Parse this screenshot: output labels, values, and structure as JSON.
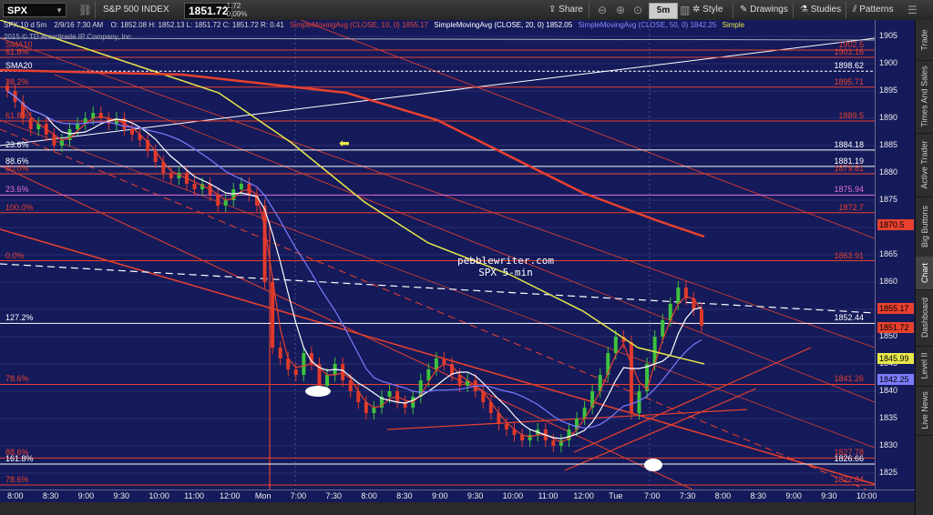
{
  "toolbar": {
    "symbol": "SPX",
    "index_name": "S&P 500 INDEX",
    "last_price": "1851.72",
    "change": "-1.72",
    "change_pct": "-0.09%",
    "share_label": "Share",
    "timeframe": "5m",
    "style_label": "Style",
    "drawings_label": "Drawings",
    "studies_label": "Studies",
    "patterns_label": "Patterns"
  },
  "legend": {
    "header": "SPX 10 d 5m",
    "date": "2/9/16 7:30 AM",
    "ohlc": "O: 1852.08  H: 1852.13  L: 1851.72  C: 1851.72  R: 0.41",
    "sma10": "SimpleMovingAvg (CLOSE, 10, 0)",
    "sma10_val": "1855.17",
    "sma20": "SimpleMovingAvg (CLOSE, 20, 0)",
    "sma20_val": "1852.05",
    "sma50": "SimpleMovingAvg (CLOSE, 50, 0)",
    "sma50_val": "1842.25",
    "sma_more": "Simple"
  },
  "copyright": "2015 © TD Ameritrade IP Company, Inc.",
  "watermark": {
    "line1": "pebblewriter.com",
    "line2": "SPX 5-min"
  },
  "sidebar_tabs": [
    "Trade",
    "Times And Sales",
    "Active Trader",
    "Big Buttons",
    "Chart",
    "Dashboard",
    "Level II",
    "Live News"
  ],
  "colors": {
    "bg": "#151a5a",
    "red": "#e8412e",
    "white": "#ffffff",
    "yellow": "#e8e84a",
    "blue": "#7b7bff",
    "candle_up": "#3ec23e",
    "candle_down": "#e03a2a"
  },
  "chart_data": {
    "type": "candlestick",
    "ylim": [
      1822,
      1908
    ],
    "y_ticks": [
      1825,
      1830,
      1835,
      1840,
      1845,
      1850,
      1855,
      1860,
      1865,
      1870,
      1875,
      1880,
      1885,
      1890,
      1895,
      1900,
      1905
    ],
    "x_ticks": [
      "8:00",
      "8:30",
      "9:00",
      "9:30",
      "10:00",
      "11:00",
      "12:00",
      "Mon",
      "7:00",
      "7:30",
      "8:00",
      "8:30",
      "9:00",
      "9:30",
      "10:00",
      "11:00",
      "12:00",
      "Tue",
      "7:00",
      "7:30",
      "8:00",
      "8:30",
      "9:00",
      "9:30",
      "10:00"
    ],
    "horizontal_levels": [
      {
        "value": 1901.16,
        "left_label": "61.8%",
        "right_label": "1901.16",
        "color": "#e8412e"
      },
      {
        "value": 1902.5,
        "left_label": "SMA10",
        "right_label": "1902.5",
        "color": "#e8412e"
      },
      {
        "value": 1898.62,
        "left_label": "SMA20",
        "right_label": "1898.62",
        "color": "#ffffff"
      },
      {
        "value": 1895.71,
        "left_label": "38.2%",
        "right_label": "1895.71",
        "color": "#e8412e"
      },
      {
        "value": 1889.5,
        "left_label": "61.8%",
        "right_label": "1889.5",
        "color": "#e8412e"
      },
      {
        "value": 1884.18,
        "left_label": "23.6%",
        "right_label": "1884.18",
        "color": "#ffffff"
      },
      {
        "value": 1881.19,
        "left_label": "88.6%",
        "right_label": "1881.19",
        "color": "#ffffff"
      },
      {
        "value": 1879.81,
        "left_label": "50.0%",
        "right_label": "1879.81",
        "color": "#e8412e"
      },
      {
        "value": 1875.94,
        "left_label": "23.6%",
        "right_label": "1875.94",
        "color": "#e070e0"
      },
      {
        "value": 1872.7,
        "left_label": "100.0%",
        "right_label": "1872.7",
        "color": "#e8412e"
      },
      {
        "value": 1863.91,
        "left_label": "0.0%",
        "right_label": "1863.91",
        "color": "#e8412e"
      },
      {
        "value": 1852.44,
        "left_label": "127.2%",
        "right_label": "1852.44",
        "color": "#ffffff"
      },
      {
        "value": 1841.26,
        "left_label": "78.6%",
        "right_label": "1841.26",
        "color": "#e8412e"
      },
      {
        "value": 1827.78,
        "left_label": "88.6%",
        "right_label": "1827.78",
        "color": "#e8412e"
      },
      {
        "value": 1826.66,
        "left_label": "161.8%",
        "right_label": "1826.66",
        "color": "#ffffff"
      },
      {
        "value": 1822.84,
        "left_label": "78.6%",
        "right_label": "1822.84",
        "color": "#e8412e"
      }
    ],
    "price_boxes": [
      {
        "value": 1870.5,
        "label": "1870.5",
        "color": "#e8412e"
      },
      {
        "value": 1855.17,
        "label": "1855.17",
        "color": "#e8412e"
      },
      {
        "value": 1851.72,
        "label": "1851.72",
        "color": "#e8412e"
      },
      {
        "value": 1845.99,
        "label": "1845.99",
        "color": "#e8e84a"
      },
      {
        "value": 1842.25,
        "label": "1842.25",
        "color": "#7b7bff"
      }
    ],
    "candles_close": [
      1895,
      1893,
      1890,
      1888,
      1889,
      1887,
      1885,
      1886,
      1888,
      1889,
      1890,
      1891,
      1890,
      1889,
      1890,
      1888,
      1887,
      1886,
      1884,
      1882,
      1880,
      1879,
      1880,
      1878,
      1877,
      1878,
      1876,
      1874,
      1875,
      1877,
      1878,
      1876,
      1874,
      1860,
      1848,
      1846,
      1844,
      1843,
      1847,
      1845,
      1841,
      1843,
      1845,
      1842,
      1840,
      1838,
      1836,
      1837,
      1839,
      1840,
      1838,
      1837,
      1839,
      1842,
      1844,
      1846,
      1845,
      1843,
      1841,
      1842,
      1840,
      1838,
      1836,
      1834,
      1833,
      1832,
      1831,
      1832,
      1833,
      1831,
      1830,
      1831,
      1833,
      1835,
      1837,
      1840,
      1843,
      1847,
      1850,
      1849,
      1836,
      1840,
      1845,
      1850,
      1853,
      1856,
      1859,
      1857,
      1855,
      1852
    ],
    "sma_lines": [
      {
        "name": "SMA10",
        "color": "#e8412e"
      },
      {
        "name": "SMA20",
        "color": "#ffffff"
      },
      {
        "name": "SMA50",
        "color": "#7b7bff"
      },
      {
        "name": "SMA200",
        "color": "#e8e84a"
      }
    ]
  }
}
